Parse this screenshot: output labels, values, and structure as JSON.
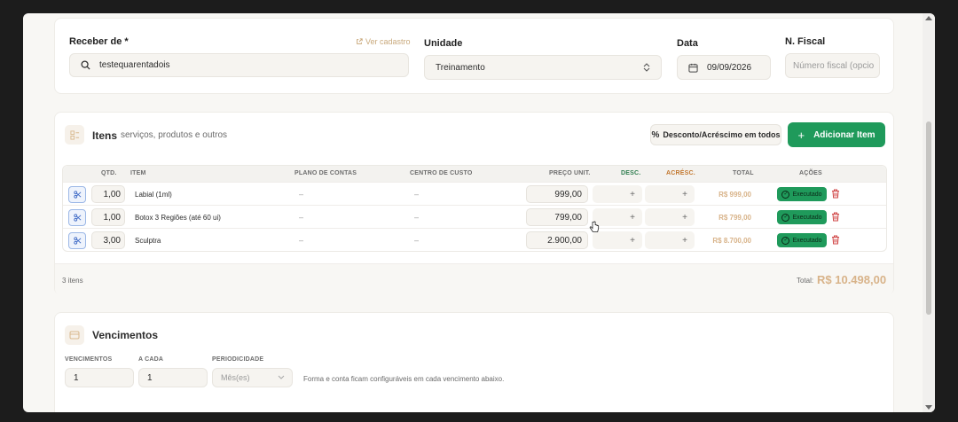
{
  "header": {
    "receber_label": "Receber de *",
    "ver_cadastro": "Ver cadastro",
    "search_value": "testequarentadois",
    "unidade_label": "Unidade",
    "unidade_value": "Treinamento",
    "data_label": "Data",
    "data_value": "09/09/2026",
    "nfiscal_label": "N. Fiscal",
    "nfiscal_placeholder": "Número fiscal (opcio"
  },
  "items": {
    "title": "Itens",
    "subtitle": "serviços, produtos e outros",
    "discount_button": "Desconto/Acréscimo em todos",
    "add_button": "Adicionar Item",
    "columns": {
      "qtd": "QTD.",
      "item": "ITEM",
      "plano": "PLANO DE CONTAS",
      "centro": "CENTRO DE CUSTO",
      "preco": "PREÇO UNIT.",
      "desc": "DESC.",
      "acresc": "ACRÉSC.",
      "total": "TOTAL",
      "acoes": "AÇÕES"
    },
    "rows": [
      {
        "qtd": "1,00",
        "item": "Labial (1ml)",
        "plano": "–",
        "centro": "–",
        "preco": "999,00",
        "desc": "+",
        "acresc": "+",
        "total": "R$ 999,00",
        "status": "Executado"
      },
      {
        "qtd": "1,00",
        "item": "Botox 3 Regiões (até 60 ui)",
        "plano": "–",
        "centro": "–",
        "preco": "799,00",
        "desc": "+",
        "acresc": "+",
        "total": "R$ 799,00",
        "status": "Executado"
      },
      {
        "qtd": "3,00",
        "item": "Sculptra",
        "plano": "–",
        "centro": "–",
        "preco": "2.900,00",
        "desc": "+",
        "acresc": "+",
        "total": "R$ 8.700,00",
        "status": "Executado"
      }
    ],
    "count_text": "3 itens",
    "total_label": "Total:",
    "total_value": "R$ 10.498,00"
  },
  "vencimentos": {
    "title": "Vencimentos",
    "venc_label": "VENCIMENTOS",
    "venc_value": "1",
    "acada_label": "A CADA",
    "acada_value": "1",
    "period_label": "PERIODICIDADE",
    "period_value": "Mês(es)",
    "note": "Forma e conta ficam configuráveis em cada vencimento abaixo."
  },
  "colors": {
    "accent_green": "#1f9a5b",
    "gold": "#d8b389",
    "desc_color": "#2f7d4f",
    "acresc_color": "#c2772e"
  }
}
